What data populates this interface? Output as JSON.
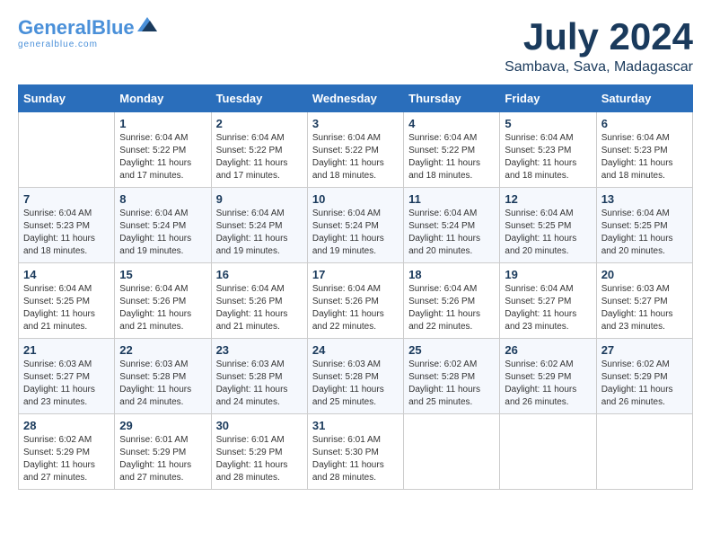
{
  "logo": {
    "name_part1": "General",
    "name_part2": "Blue",
    "tagline": "generalblue.com"
  },
  "title": "July 2024",
  "subtitle": "Sambava, Sava, Madagascar",
  "headers": [
    "Sunday",
    "Monday",
    "Tuesday",
    "Wednesday",
    "Thursday",
    "Friday",
    "Saturday"
  ],
  "weeks": [
    [
      {
        "day": "",
        "info": ""
      },
      {
        "day": "1",
        "info": "Sunrise: 6:04 AM\nSunset: 5:22 PM\nDaylight: 11 hours\nand 17 minutes."
      },
      {
        "day": "2",
        "info": "Sunrise: 6:04 AM\nSunset: 5:22 PM\nDaylight: 11 hours\nand 17 minutes."
      },
      {
        "day": "3",
        "info": "Sunrise: 6:04 AM\nSunset: 5:22 PM\nDaylight: 11 hours\nand 18 minutes."
      },
      {
        "day": "4",
        "info": "Sunrise: 6:04 AM\nSunset: 5:22 PM\nDaylight: 11 hours\nand 18 minutes."
      },
      {
        "day": "5",
        "info": "Sunrise: 6:04 AM\nSunset: 5:23 PM\nDaylight: 11 hours\nand 18 minutes."
      },
      {
        "day": "6",
        "info": "Sunrise: 6:04 AM\nSunset: 5:23 PM\nDaylight: 11 hours\nand 18 minutes."
      }
    ],
    [
      {
        "day": "7",
        "info": "Sunrise: 6:04 AM\nSunset: 5:23 PM\nDaylight: 11 hours\nand 18 minutes."
      },
      {
        "day": "8",
        "info": "Sunrise: 6:04 AM\nSunset: 5:24 PM\nDaylight: 11 hours\nand 19 minutes."
      },
      {
        "day": "9",
        "info": "Sunrise: 6:04 AM\nSunset: 5:24 PM\nDaylight: 11 hours\nand 19 minutes."
      },
      {
        "day": "10",
        "info": "Sunrise: 6:04 AM\nSunset: 5:24 PM\nDaylight: 11 hours\nand 19 minutes."
      },
      {
        "day": "11",
        "info": "Sunrise: 6:04 AM\nSunset: 5:24 PM\nDaylight: 11 hours\nand 20 minutes."
      },
      {
        "day": "12",
        "info": "Sunrise: 6:04 AM\nSunset: 5:25 PM\nDaylight: 11 hours\nand 20 minutes."
      },
      {
        "day": "13",
        "info": "Sunrise: 6:04 AM\nSunset: 5:25 PM\nDaylight: 11 hours\nand 20 minutes."
      }
    ],
    [
      {
        "day": "14",
        "info": "Sunrise: 6:04 AM\nSunset: 5:25 PM\nDaylight: 11 hours\nand 21 minutes."
      },
      {
        "day": "15",
        "info": "Sunrise: 6:04 AM\nSunset: 5:26 PM\nDaylight: 11 hours\nand 21 minutes."
      },
      {
        "day": "16",
        "info": "Sunrise: 6:04 AM\nSunset: 5:26 PM\nDaylight: 11 hours\nand 21 minutes."
      },
      {
        "day": "17",
        "info": "Sunrise: 6:04 AM\nSunset: 5:26 PM\nDaylight: 11 hours\nand 22 minutes."
      },
      {
        "day": "18",
        "info": "Sunrise: 6:04 AM\nSunset: 5:26 PM\nDaylight: 11 hours\nand 22 minutes."
      },
      {
        "day": "19",
        "info": "Sunrise: 6:04 AM\nSunset: 5:27 PM\nDaylight: 11 hours\nand 23 minutes."
      },
      {
        "day": "20",
        "info": "Sunrise: 6:03 AM\nSunset: 5:27 PM\nDaylight: 11 hours\nand 23 minutes."
      }
    ],
    [
      {
        "day": "21",
        "info": "Sunrise: 6:03 AM\nSunset: 5:27 PM\nDaylight: 11 hours\nand 23 minutes."
      },
      {
        "day": "22",
        "info": "Sunrise: 6:03 AM\nSunset: 5:28 PM\nDaylight: 11 hours\nand 24 minutes."
      },
      {
        "day": "23",
        "info": "Sunrise: 6:03 AM\nSunset: 5:28 PM\nDaylight: 11 hours\nand 24 minutes."
      },
      {
        "day": "24",
        "info": "Sunrise: 6:03 AM\nSunset: 5:28 PM\nDaylight: 11 hours\nand 25 minutes."
      },
      {
        "day": "25",
        "info": "Sunrise: 6:02 AM\nSunset: 5:28 PM\nDaylight: 11 hours\nand 25 minutes."
      },
      {
        "day": "26",
        "info": "Sunrise: 6:02 AM\nSunset: 5:29 PM\nDaylight: 11 hours\nand 26 minutes."
      },
      {
        "day": "27",
        "info": "Sunrise: 6:02 AM\nSunset: 5:29 PM\nDaylight: 11 hours\nand 26 minutes."
      }
    ],
    [
      {
        "day": "28",
        "info": "Sunrise: 6:02 AM\nSunset: 5:29 PM\nDaylight: 11 hours\nand 27 minutes."
      },
      {
        "day": "29",
        "info": "Sunrise: 6:01 AM\nSunset: 5:29 PM\nDaylight: 11 hours\nand 27 minutes."
      },
      {
        "day": "30",
        "info": "Sunrise: 6:01 AM\nSunset: 5:29 PM\nDaylight: 11 hours\nand 28 minutes."
      },
      {
        "day": "31",
        "info": "Sunrise: 6:01 AM\nSunset: 5:30 PM\nDaylight: 11 hours\nand 28 minutes."
      },
      {
        "day": "",
        "info": ""
      },
      {
        "day": "",
        "info": ""
      },
      {
        "day": "",
        "info": ""
      }
    ]
  ]
}
